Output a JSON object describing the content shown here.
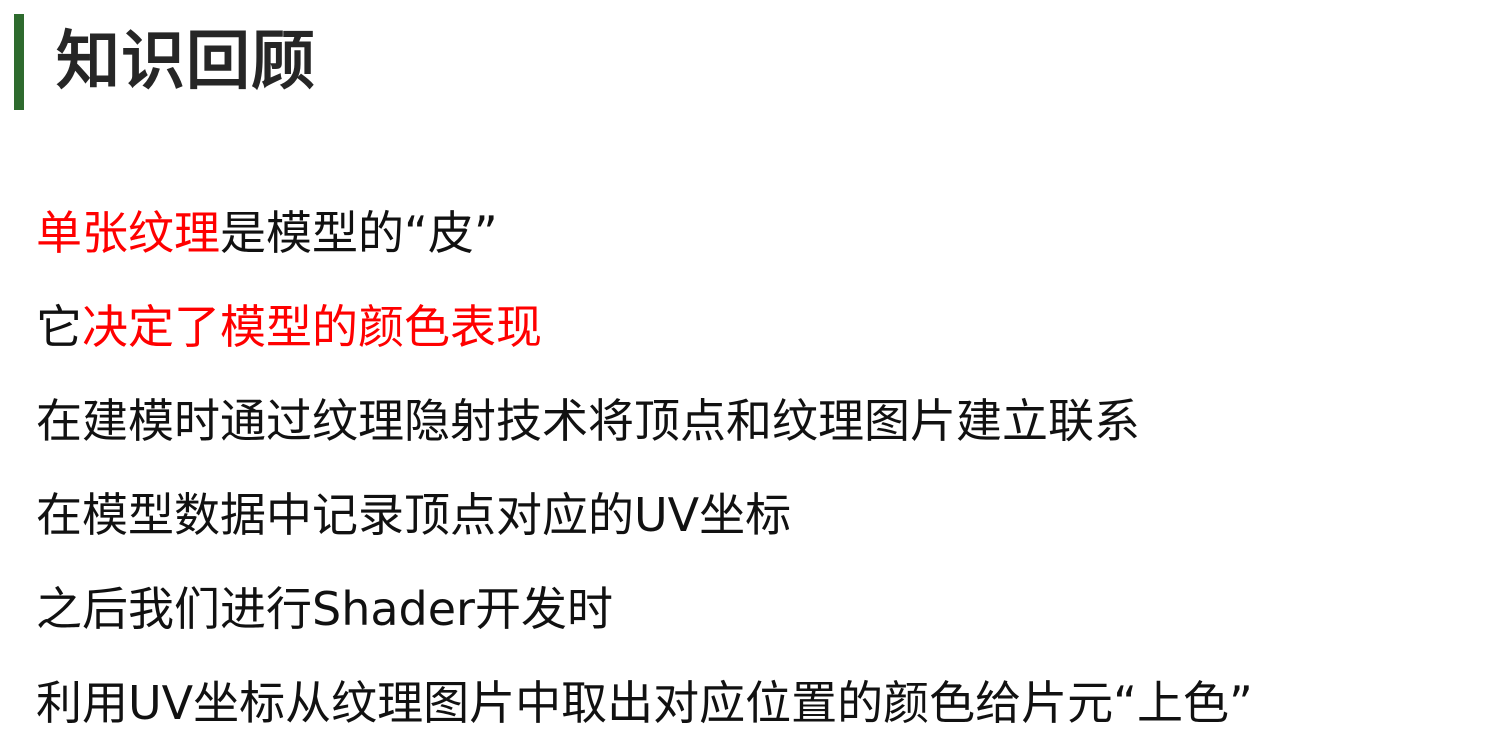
{
  "header": {
    "title": "知识回顾",
    "accent_color": "#2e6b2e"
  },
  "highlight_color": "#ff0000",
  "lines": [
    {
      "parts": [
        {
          "text": "单张纹理",
          "highlight": true
        },
        {
          "text": "是模型的“皮”",
          "highlight": false
        }
      ]
    },
    {
      "parts": [
        {
          "text": "它",
          "highlight": false
        },
        {
          "text": "决定了模型的颜色表现",
          "highlight": true
        }
      ]
    },
    {
      "parts": [
        {
          "text": "在建模时通过纹理隐射技术将顶点和纹理图片建立联系",
          "highlight": false
        }
      ]
    },
    {
      "parts": [
        {
          "text": "在模型数据中记录顶点对应的UV坐标",
          "highlight": false
        }
      ]
    },
    {
      "parts": [
        {
          "text": "之后我们进行Shader开发时",
          "highlight": false
        }
      ]
    },
    {
      "parts": [
        {
          "text": "利用UV坐标从纹理图片中取出对应位置的颜色给片元“上色”",
          "highlight": false
        }
      ]
    }
  ]
}
